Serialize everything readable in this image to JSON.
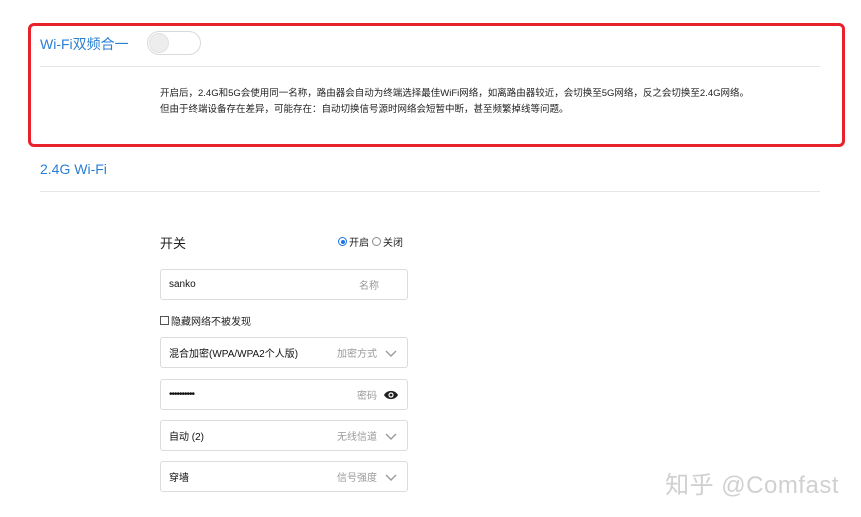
{
  "dual_band": {
    "title": "Wi-Fi双频合一",
    "enabled": false,
    "description_line1": "开启后，2.4G和5G会使用同一名称，路由器会自动为终端选择最佳WiFi网络，如离路由器较近，会切换至5G网络，反之会切换至2.4G网络。",
    "description_line2": "但由于终端设备存在差异，可能存在：自动切换信号源时网络会短暂中断，甚至频繁掉线等问题。"
  },
  "wifi_24g": {
    "title": "2.4G Wi-Fi",
    "switch_label": "开关",
    "switch_on_label": "开启",
    "switch_off_label": "关闭",
    "switch_selected": "开启",
    "name_value": "sanko",
    "name_hint": "名称",
    "hide_network_label": "隐藏网络不被发现",
    "hide_network_checked": false,
    "encryption_value": "混合加密(WPA/WPA2个人版)",
    "encryption_hint": "加密方式",
    "password_value": "••••••••••",
    "password_hint": "密码",
    "channel_value": "自动 (2)",
    "channel_hint": "无线信道",
    "signal_value": "穿墙",
    "signal_hint": "信号强度"
  },
  "watermark": "知乎 @Comfast",
  "colors": {
    "accent": "#2a7fd4",
    "highlight_border": "#e8222a",
    "radio_selected": "#1a73e8"
  }
}
